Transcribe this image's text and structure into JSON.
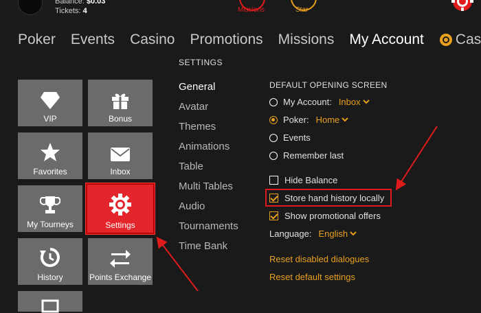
{
  "account": {
    "balance_label": "Balance:",
    "balance_value": "$0.03",
    "tickets_label": "Tickets:",
    "tickets_value": "4"
  },
  "top_icons": [
    {
      "label": "Missions",
      "color": "#e01b1b"
    },
    {
      "label": "Star",
      "color": "#e8a01e"
    }
  ],
  "nav": {
    "items": [
      "Poker",
      "Events",
      "Casino",
      "Promotions",
      "Missions",
      "My Account"
    ],
    "active": "My Account",
    "cashier_label": "Cashie"
  },
  "settings_title": "SETTINGS",
  "tiles": [
    {
      "label": "VIP",
      "icon": "diamond-icon"
    },
    {
      "label": "Bonus",
      "icon": "gift-icon"
    },
    {
      "label": "Favorites",
      "icon": "star-icon"
    },
    {
      "label": "Inbox",
      "icon": "envelope-icon"
    },
    {
      "label": "My Tourneys",
      "icon": "trophy-icon"
    },
    {
      "label": "Settings",
      "icon": "gear-icon",
      "active": true
    },
    {
      "label": "History",
      "icon": "history-icon"
    },
    {
      "label": "Points Exchange",
      "icon": "exchange-icon"
    }
  ],
  "submenu": [
    "General",
    "Avatar",
    "Themes",
    "Animations",
    "Table",
    "Multi Tables",
    "Audio",
    "Tournaments",
    "Time Bank"
  ],
  "submenu_selected": "General",
  "options": {
    "title": "DEFAULT OPENING SCREEN",
    "radios": [
      {
        "label": "My Account:",
        "dropdown": "Inbox",
        "checked": false
      },
      {
        "label": "Poker:",
        "dropdown": "Home",
        "checked": true
      },
      {
        "label": "Events",
        "checked": false
      },
      {
        "label": "Remember last",
        "checked": false
      }
    ],
    "checks": [
      {
        "label": "Hide Balance",
        "checked": false
      },
      {
        "label": "Store hand history locally",
        "checked": true
      },
      {
        "label": "Show promotional offers",
        "checked": true
      }
    ],
    "language_label": "Language:",
    "language_value": "English",
    "links": [
      "Reset disabled dialogues",
      "Reset default settings"
    ]
  },
  "colors": {
    "accent": "#e8a01e",
    "active_tile": "#e4262c",
    "tile": "#6b6b6b",
    "annotation": "#e01b1b"
  }
}
